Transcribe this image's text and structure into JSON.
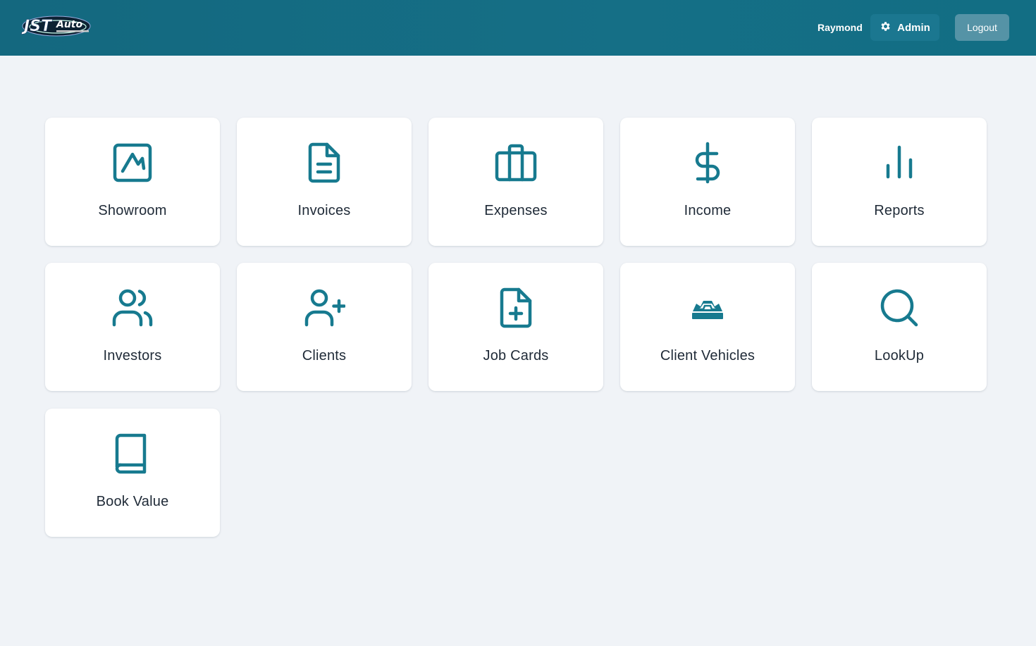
{
  "header": {
    "logo_icon": "jst-auto-logo",
    "user_name": "Raymond",
    "admin_label": "Admin",
    "admin_icon": "gear-icon",
    "logout_label": "Logout",
    "accent_color": "#146a80"
  },
  "tiles": [
    {
      "label": "Showroom",
      "icon": "trend-chart-icon"
    },
    {
      "label": "Invoices",
      "icon": "document-icon"
    },
    {
      "label": "Expenses",
      "icon": "briefcase-icon"
    },
    {
      "label": "Income",
      "icon": "dollar-icon"
    },
    {
      "label": "Reports",
      "icon": "bar-chart-icon"
    },
    {
      "label": "Investors",
      "icon": "users-icon"
    },
    {
      "label": "Clients",
      "icon": "user-plus-icon"
    },
    {
      "label": "Job Cards",
      "icon": "file-plus-icon"
    },
    {
      "label": "Client Vehicles",
      "icon": "vehicle-icon"
    },
    {
      "label": "LookUp",
      "icon": "search-icon"
    },
    {
      "label": "Book Value",
      "icon": "book-icon"
    }
  ],
  "icon_color": "#177a8f"
}
